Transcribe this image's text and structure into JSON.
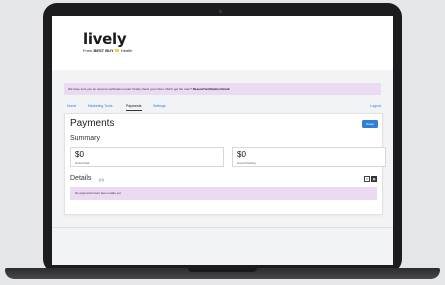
{
  "brand": {
    "logo_text": "lively",
    "tagline_prefix": "From ",
    "tagline_brand": "BEST BUY",
    "tagline_suffix": " Health"
  },
  "alert": {
    "message": "We have sent you an account verification email. Kindly check your inbox. Didn't get the mail ? ",
    "action": "Resend Verification Email"
  },
  "nav": {
    "tabs": [
      "Home",
      "Marketing Tools",
      "Payments",
      "Settings"
    ],
    "active": "Payments",
    "logout": "Logout"
  },
  "page": {
    "title": "Payments",
    "setup_button": "Setup",
    "summary_title": "Summary",
    "stats": [
      {
        "value": "$0",
        "label": "Amount Paid"
      },
      {
        "value": "$0",
        "label": "Amount Pending"
      }
    ],
    "details_title": "Details",
    "details_count": "(0)",
    "empty_message": "No payments have been made yet"
  },
  "colors": {
    "accent": "#2f7fd8",
    "alert_bg": "#eadbf3"
  }
}
